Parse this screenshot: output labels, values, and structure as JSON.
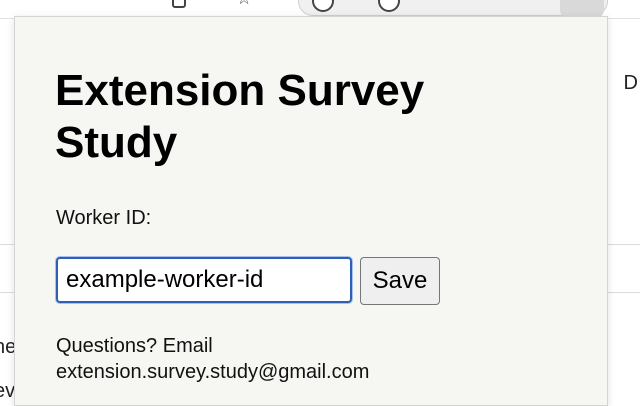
{
  "popup": {
    "title": "Extension Survey Study",
    "worker_label": "Worker ID:",
    "worker_input_value": "example-worker-id",
    "save_label": "Save",
    "contact_line1": "Questions? Email",
    "contact_email": "extension.survey.study@gmail.com"
  },
  "background_page": {
    "right_fragment": "D",
    "left_fragment_1": "ne",
    "left_fragment_2": "ev"
  },
  "colors": {
    "popup_bg": "#f6f6f2",
    "input_focus_border": "#2f5fb3",
    "button_bg": "#efefef"
  },
  "icons": [
    "extension-icon",
    "star-icon",
    "profile-icon",
    "menu-icon"
  ]
}
